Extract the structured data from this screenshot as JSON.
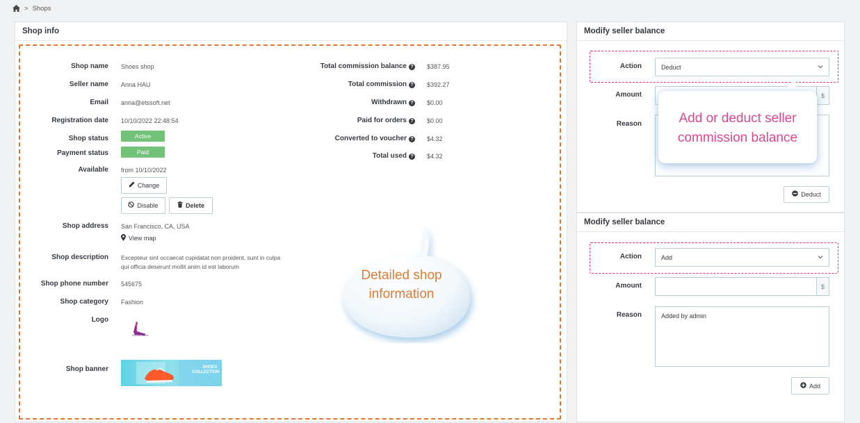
{
  "breadcrumb": {
    "home_icon": "home-icon",
    "separator": ">",
    "current": "Shops"
  },
  "shop_info": {
    "title": "Shop info",
    "left_fields": [
      {
        "label": "Shop name",
        "value": "Shoes shop"
      },
      {
        "label": "Seller name",
        "value": "Anna HAU"
      },
      {
        "label": "Email",
        "value": "anna@etssoft.net"
      },
      {
        "label": "Registration date",
        "value": "10/10/2022 22:48:54"
      }
    ],
    "shop_status_label": "Shop status",
    "shop_status_value": "Active",
    "payment_status_label": "Payment status",
    "payment_status_value": "Paid",
    "available_label": "Available",
    "available_value": "from 10/10/2022",
    "change_button": "Change",
    "disable_button": "Disable",
    "delete_button": "Delete",
    "address_label": "Shop address",
    "address_value": "San Francisco, CA, USA",
    "view_map": "View map",
    "description_label": "Shop description",
    "description_value": "Excepteur sint occaecat cupidatat non proident, sunt in culpa qui officia deserunt mollit anim id est laborum",
    "phone_label": "Shop phone number",
    "phone_value": "545675",
    "category_label": "Shop category",
    "category_value": "Fashion",
    "logo_label": "Logo",
    "logo_text": "Shoes store",
    "banner_label": "Shop banner",
    "banner_text_1": "SHOES",
    "banner_text_2": "COLLECTION",
    "right_fields": [
      {
        "label": "Total commission balance",
        "value": "$387.95"
      },
      {
        "label": "Total commission",
        "value": "$392.27"
      },
      {
        "label": "Withdrawn",
        "value": "$0.00"
      },
      {
        "label": "Paid for orders",
        "value": "$0.00"
      },
      {
        "label": "Converted to voucher",
        "value": "$4.32"
      },
      {
        "label": "Total used",
        "value": "$4.32"
      }
    ],
    "help_icon_glyph": "?",
    "bubble_text": "Detailed shop information"
  },
  "balance_deduct": {
    "title": "Modify seller balance",
    "action_label": "Action",
    "action_value": "Deduct",
    "amount_label": "Amount",
    "currency": "$",
    "reason_label": "Reason",
    "submit": "Deduct",
    "callout": "Add or deduct seller commission balance"
  },
  "balance_add": {
    "title": "Modify seller balance",
    "action_label": "Action",
    "action_value": "Add",
    "amount_label": "Amount",
    "currency": "$",
    "reason_label": "Reason",
    "reason_value": "Added by admin",
    "submit": "Add"
  },
  "colors": {
    "badge_green": "#72c279",
    "highlight_orange": "#e2762a",
    "highlight_pink": "#e8307b",
    "bubble_text": "#e07b32",
    "callout_text": "#e0478b"
  }
}
